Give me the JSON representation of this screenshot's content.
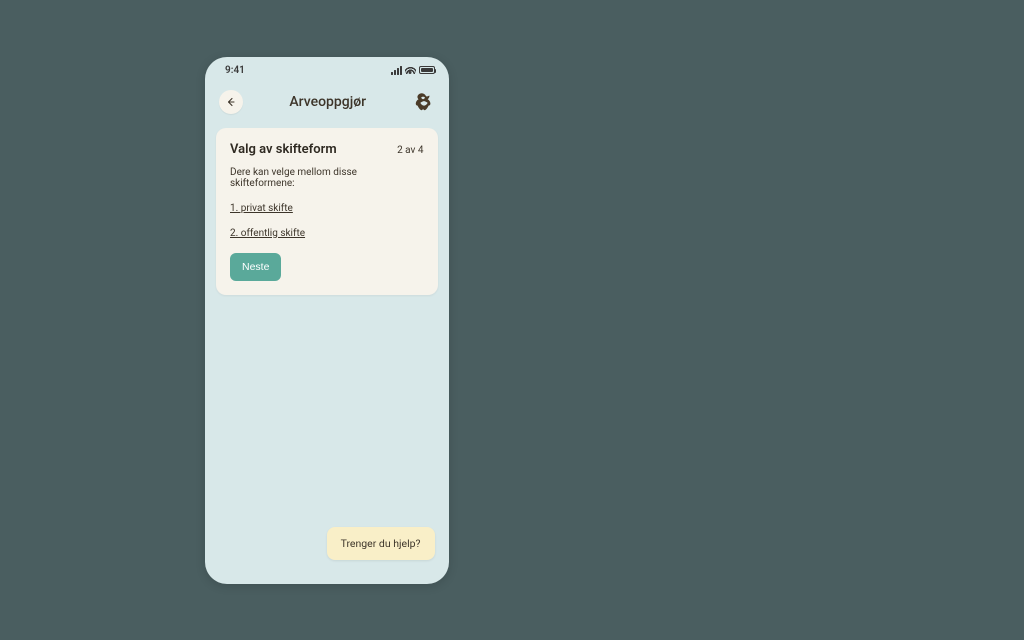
{
  "status": {
    "time": "9:41"
  },
  "header": {
    "title": "Arveoppgjør"
  },
  "card": {
    "title": "Valg av skifteform",
    "step": "2 av 4",
    "description": "Dere kan velge mellom disse skifteformene:",
    "options": [
      "1. privat skifte",
      "2. offentlig skifte"
    ],
    "next_label": "Neste"
  },
  "help": {
    "label": "Trenger du hjelp?"
  }
}
